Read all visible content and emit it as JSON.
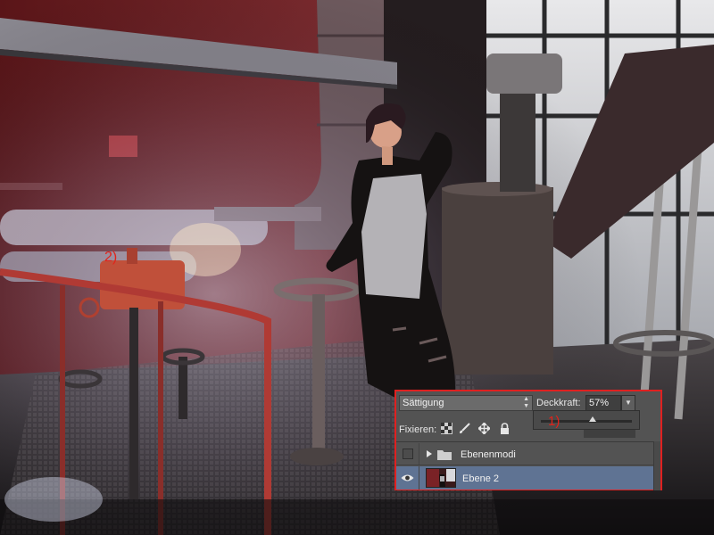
{
  "annotations": {
    "label_1": "1)",
    "label_2": "2)"
  },
  "layers_panel": {
    "blend_mode": "Sättigung",
    "opacity_label": "Deckkraft:",
    "opacity_value": "57%",
    "opacity_fraction": 0.57,
    "lock_label": "Fixieren:",
    "layers": [
      {
        "name": "Ebenenmodi",
        "type": "group",
        "visible": false,
        "selected": false
      },
      {
        "name": "Ebene 2",
        "type": "pixel",
        "visible": true,
        "selected": true
      }
    ]
  },
  "colors": {
    "annotation_red": "#e2231a",
    "panel_bg": "#535353",
    "selection_blue": "#5f7393"
  },
  "icons": {
    "lock_transparent": "checkerboard-icon",
    "lock_image": "brush-icon",
    "lock_position": "move-arrows-icon",
    "lock_all": "padlock-icon",
    "visibility": "eye-icon",
    "expand": "disclosure-triangle-icon",
    "group": "folder-icon"
  }
}
